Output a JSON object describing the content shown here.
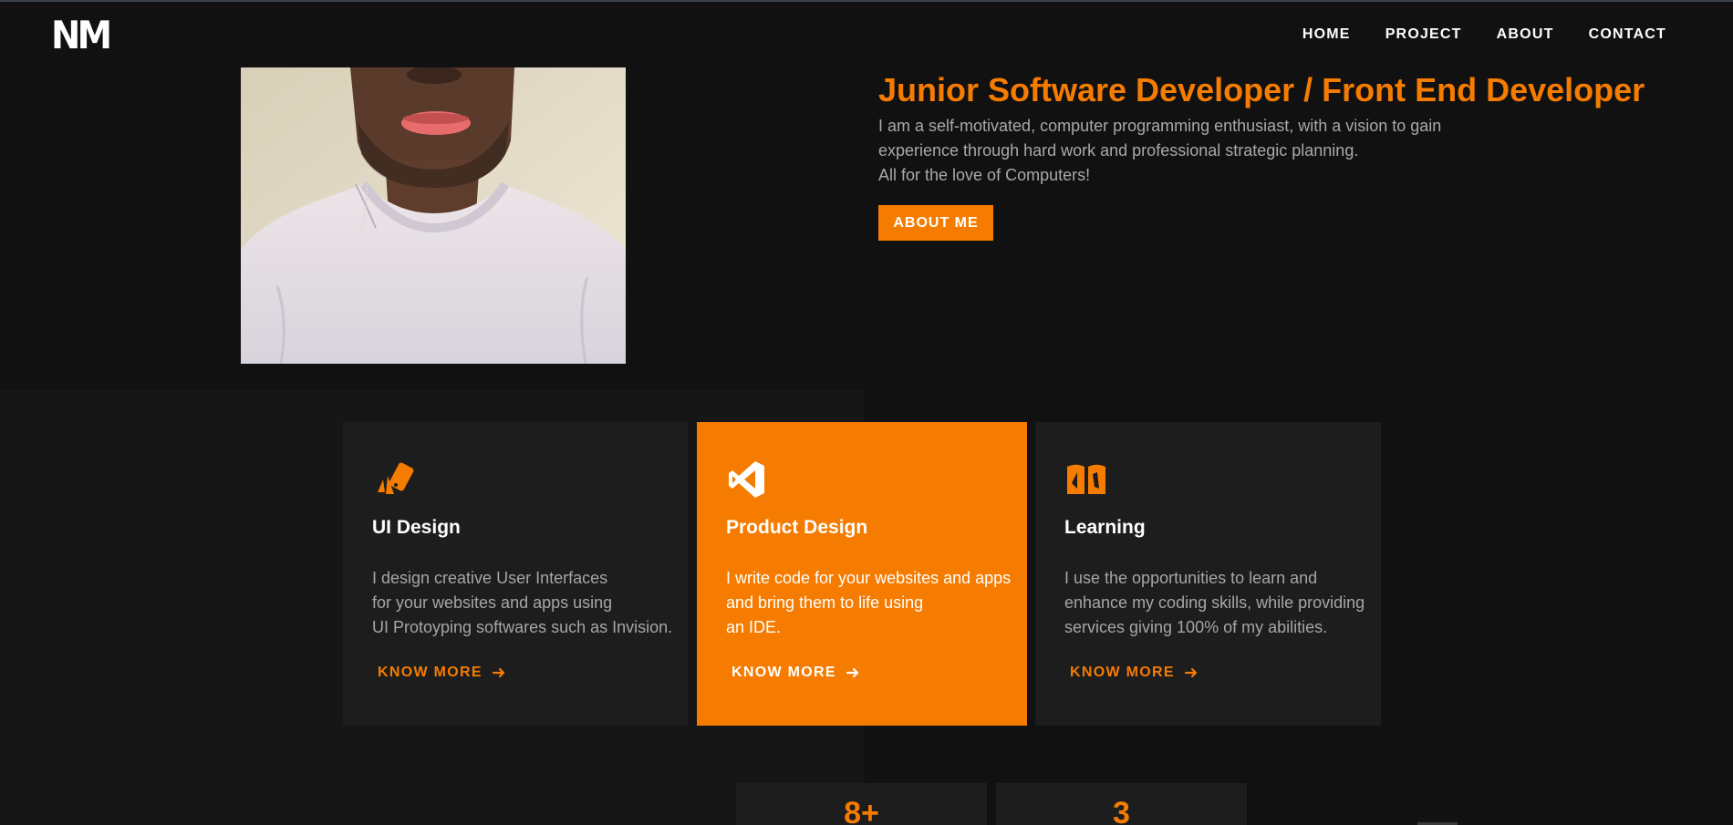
{
  "brand": {
    "logo": "NM"
  },
  "nav": {
    "items": [
      "HOME",
      "PROJECT",
      "ABOUT",
      "CONTACT"
    ]
  },
  "hero": {
    "title": "Junior Software Developer / Front End Developer",
    "description": [
      "I am a self-motivated, computer programming enthusiast, with a vision to gain",
      "experience through hard work and professional strategic planning.",
      "All for the love of Computers!"
    ],
    "button": "ABOUT ME"
  },
  "services": [
    {
      "icon": "design-cards-icon",
      "title": "UI Design",
      "text": [
        "I design creative User Interfaces",
        "for your websites and apps using",
        "UI Protoyping softwares such as Invision."
      ],
      "link": "KNOW MORE"
    },
    {
      "icon": "vscode-icon",
      "title": "Product Design",
      "text": [
        "I write code for your websites and apps",
        "and bring them to life using",
        "an IDE."
      ],
      "link": "KNOW MORE"
    },
    {
      "icon": "book-icon",
      "title": "Learning",
      "text": [
        "I use the opportunities to learn and",
        "enhance my coding skills, while providing",
        "services giving 100% of my abilities."
      ],
      "link": "KNOW MORE"
    }
  ],
  "stats": [
    "8+",
    "3"
  ],
  "colors": {
    "accent": "#f57c00",
    "background": "#111111",
    "card": "#1d1d1d"
  }
}
